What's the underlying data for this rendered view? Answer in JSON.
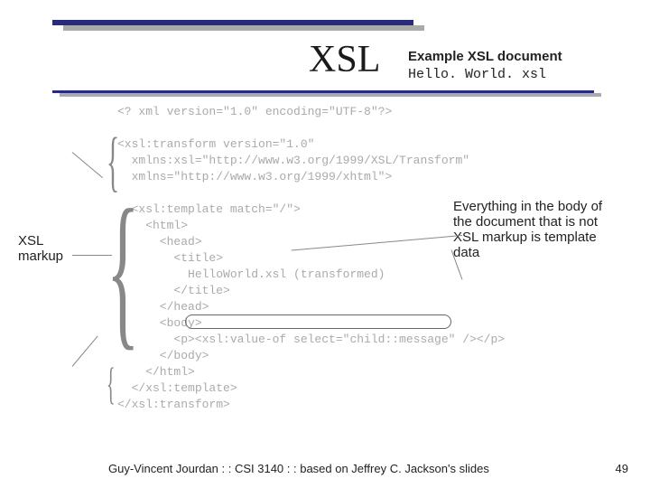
{
  "slide": {
    "title": "XSL",
    "subtitle": "Example XSL document",
    "filename": "Hello. World. xsl"
  },
  "code": "<? xml version=\"1.0\" encoding=\"UTF-8\"?>\n\n<xsl:transform version=\"1.0\"\n  xmlns:xsl=\"http://www.w3.org/1999/XSL/Transform\"\n  xmlns=\"http://www.w3.org/1999/xhtml\">\n\n  <xsl:template match=\"/\">\n    <html>\n      <head>\n        <title>\n          HelloWorld.xsl (transformed)\n        </title>\n      </head>\n      <body>\n        <p><xsl:value-of select=\"child::message\" /></p>\n      </body>\n    </html>\n  </xsl:template>\n</xsl:transform>",
  "callouts": {
    "left": "XSL markup",
    "right": "Everything in the body of the document that is not XSL markup is template data"
  },
  "footer": {
    "text": "Guy-Vincent Jourdan : : CSI 3140 : : based on Jeffrey C. Jackson's slides",
    "page": "49"
  }
}
